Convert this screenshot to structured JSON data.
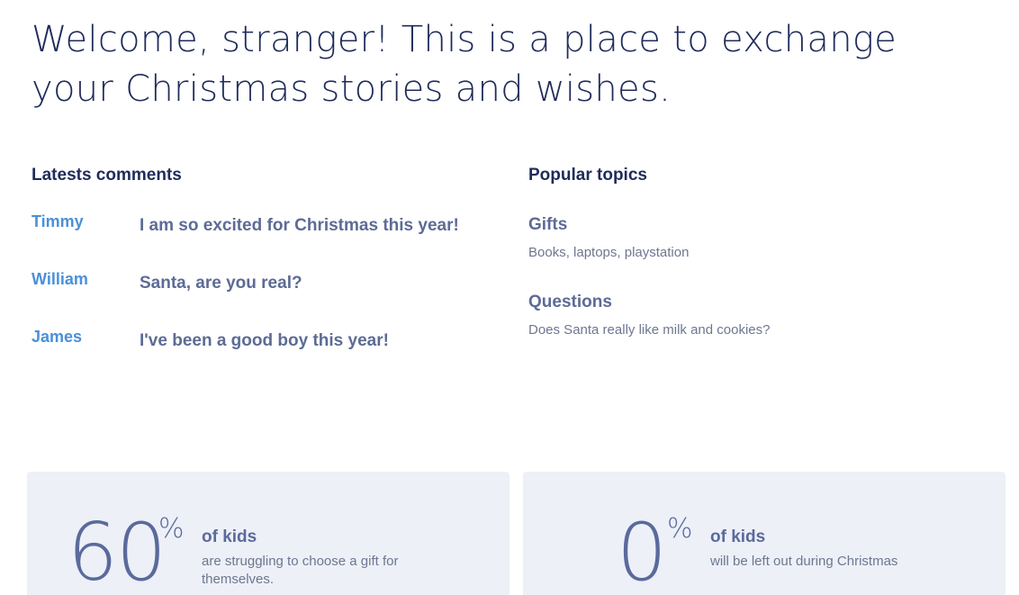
{
  "hero": {
    "title": "Welcome, stranger! This is a place to exchange your Christmas stories and wishes."
  },
  "comments": {
    "heading": "Latests comments",
    "items": [
      {
        "author": "Timmy",
        "text": "I am so excited for Christmas this year!"
      },
      {
        "author": "William",
        "text": "Santa, are you real?"
      },
      {
        "author": "James",
        "text": "I've been a good boy this year!"
      }
    ]
  },
  "topics": {
    "heading": "Popular topics",
    "items": [
      {
        "title": "Gifts",
        "description": "Books, laptops, playstation"
      },
      {
        "title": "Questions",
        "description": "Does Santa really like milk and cookies?"
      }
    ]
  },
  "stats": [
    {
      "number": "60",
      "unit": "%",
      "label": "of kids",
      "description": "are struggling to choose a gift for themselves."
    },
    {
      "number": "0",
      "unit": "%",
      "label": "of kids",
      "description": "will be left out during Christmas"
    }
  ],
  "colors": {
    "heading": "#1f2b5b",
    "author_link": "#4a90d9",
    "muted_text": "#5d6b95",
    "card_background": "#edf0f7"
  }
}
